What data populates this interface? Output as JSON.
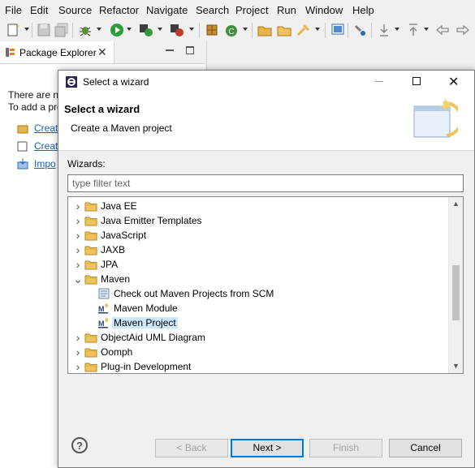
{
  "menubar": {
    "items": [
      "File",
      "Edit",
      "Source",
      "Refactor",
      "Navigate",
      "Search",
      "Project",
      "Run",
      "Window",
      "Help"
    ]
  },
  "package_explorer": {
    "tab_label": "Package Explorer",
    "message_line1": "There are no",
    "message_line2": "To add a pro",
    "links": [
      "Creat",
      "Creat",
      "Impo"
    ]
  },
  "dialog": {
    "window_title": "Select a wizard",
    "header_title": "Select a wizard",
    "header_description": "Create a Maven project",
    "wizards_label": "Wizards:",
    "filter_placeholder": "type filter text",
    "tree": [
      {
        "label": "Java EE",
        "level": 0,
        "type": "folder",
        "expander": "collapsed"
      },
      {
        "label": "Java Emitter Templates",
        "level": 0,
        "type": "folder",
        "expander": "collapsed"
      },
      {
        "label": "JavaScript",
        "level": 0,
        "type": "folder",
        "expander": "collapsed"
      },
      {
        "label": "JAXB",
        "level": 0,
        "type": "folder",
        "expander": "collapsed"
      },
      {
        "label": "JPA",
        "level": 0,
        "type": "folder",
        "expander": "collapsed"
      },
      {
        "label": "Maven",
        "level": 0,
        "type": "folder",
        "expander": "expanded"
      },
      {
        "label": "Check out Maven Projects from SCM",
        "level": 1,
        "type": "scm"
      },
      {
        "label": "Maven Module",
        "level": 1,
        "type": "maven"
      },
      {
        "label": "Maven Project",
        "level": 1,
        "type": "maven",
        "selected": true
      },
      {
        "label": "ObjectAid UML Diagram",
        "level": 0,
        "type": "folder",
        "expander": "collapsed"
      },
      {
        "label": "Oomph",
        "level": 0,
        "type": "folder",
        "expander": "collapsed"
      },
      {
        "label": "Plug-in Development",
        "level": 0,
        "type": "folder",
        "expander": "collapsed"
      }
    ],
    "buttons": {
      "help": "?",
      "back": "< Back",
      "next": "Next >",
      "finish": "Finish",
      "cancel": "Cancel"
    }
  },
  "colors": {
    "accent": "#0078d7",
    "selection": "#cce8ff",
    "link": "#1a5fb4",
    "folder": "#e8b54a"
  }
}
